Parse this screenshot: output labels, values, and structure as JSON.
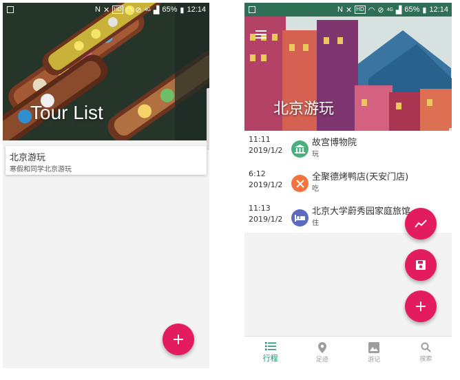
{
  "status_bar": {
    "left_icons": [
      "gallery-icon"
    ],
    "right_icons": [
      "nfc-icon",
      "mute-icon",
      "hd-badge",
      "wifi-icon",
      "sim-icon",
      "dnd-icon",
      "signal-icon"
    ],
    "hd": "HD",
    "net": "4G",
    "battery": "65%",
    "time": "12:14"
  },
  "left_screen": {
    "header_title": "Tour List",
    "tours": [
      {
        "title": "北京游玩",
        "subtitle": "寒假和同学北京游玩"
      }
    ],
    "fab_label": "+"
  },
  "right_screen": {
    "header_title": "北京游玩",
    "itinerary": [
      {
        "time": "11:11",
        "date": "2019/1/2",
        "name": "故宫博物院",
        "tag": "玩",
        "icon": "museum-icon",
        "color": "#4caf7d"
      },
      {
        "time": "6:12",
        "date": "2019/1/2",
        "name": "全聚德烤鸭店(天安门店)",
        "tag": "吃",
        "icon": "restaurant-icon",
        "color": "#f4733d"
      },
      {
        "time": "11:13",
        "date": "2019/1/2",
        "name": "北京大学蔚秀园家庭旅馆",
        "tag": "住",
        "icon": "hotel-icon",
        "color": "#5c6bc0"
      }
    ],
    "fabs": [
      "trend-icon",
      "save-icon",
      "add-icon"
    ],
    "fab_add_label": "+",
    "nav": [
      {
        "label": "行程",
        "icon": "list-icon",
        "active": true
      },
      {
        "label": "足迹",
        "icon": "location-pin-icon",
        "active": false
      },
      {
        "label": "游记",
        "icon": "photo-icon",
        "active": false
      },
      {
        "label": "搜索",
        "icon": "search-icon",
        "active": false
      }
    ]
  },
  "colors": {
    "accent": "#e31b5f",
    "active_nav": "#1e8f6e"
  }
}
